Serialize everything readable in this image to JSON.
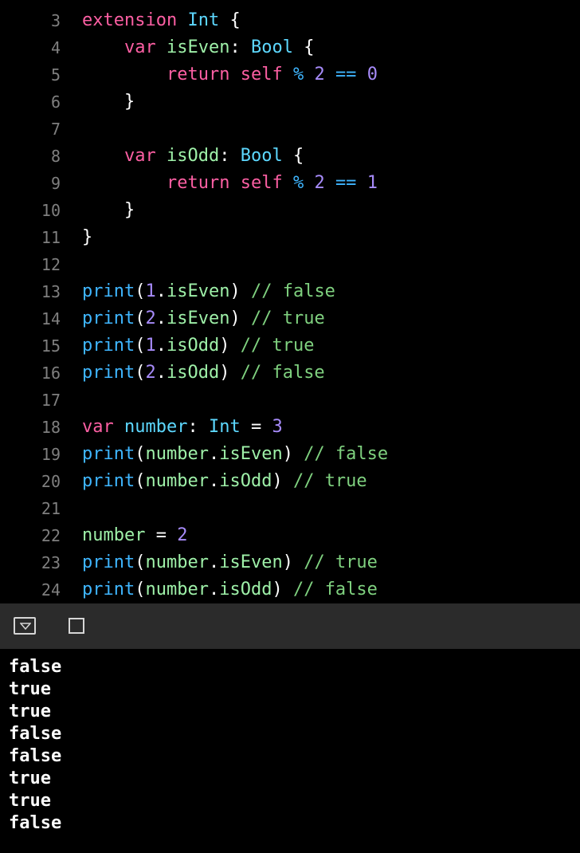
{
  "editor": {
    "lines": [
      {
        "n": "3",
        "tokens": [
          [
            "kw",
            "extension"
          ],
          [
            "pl",
            " "
          ],
          [
            "ty",
            "Int"
          ],
          [
            "pl",
            " {"
          ]
        ]
      },
      {
        "n": "4",
        "tokens": [
          [
            "pl",
            "    "
          ],
          [
            "kw",
            "var"
          ],
          [
            "pl",
            " "
          ],
          [
            "id2",
            "isEven"
          ],
          [
            "pl",
            ": "
          ],
          [
            "ty",
            "Bool"
          ],
          [
            "pl",
            " {"
          ]
        ]
      },
      {
        "n": "5",
        "tokens": [
          [
            "pl",
            "        "
          ],
          [
            "kw",
            "return"
          ],
          [
            "pl",
            " "
          ],
          [
            "kw",
            "self"
          ],
          [
            "pl",
            " "
          ],
          [
            "fn",
            "%"
          ],
          [
            "pl",
            " "
          ],
          [
            "num",
            "2"
          ],
          [
            "pl",
            " "
          ],
          [
            "fn",
            "=="
          ],
          [
            "pl",
            " "
          ],
          [
            "num",
            "0"
          ]
        ]
      },
      {
        "n": "6",
        "tokens": [
          [
            "pl",
            "    }"
          ]
        ]
      },
      {
        "n": "7",
        "tokens": []
      },
      {
        "n": "8",
        "tokens": [
          [
            "pl",
            "    "
          ],
          [
            "kw",
            "var"
          ],
          [
            "pl",
            " "
          ],
          [
            "id2",
            "isOdd"
          ],
          [
            "pl",
            ": "
          ],
          [
            "ty",
            "Bool"
          ],
          [
            "pl",
            " {"
          ]
        ]
      },
      {
        "n": "9",
        "tokens": [
          [
            "pl",
            "        "
          ],
          [
            "kw",
            "return"
          ],
          [
            "pl",
            " "
          ],
          [
            "kw",
            "self"
          ],
          [
            "pl",
            " "
          ],
          [
            "fn",
            "%"
          ],
          [
            "pl",
            " "
          ],
          [
            "num",
            "2"
          ],
          [
            "pl",
            " "
          ],
          [
            "fn",
            "=="
          ],
          [
            "pl",
            " "
          ],
          [
            "num",
            "1"
          ]
        ]
      },
      {
        "n": "10",
        "tokens": [
          [
            "pl",
            "    }"
          ]
        ]
      },
      {
        "n": "11",
        "tokens": [
          [
            "pl",
            "}"
          ]
        ]
      },
      {
        "n": "12",
        "tokens": []
      },
      {
        "n": "13",
        "tokens": [
          [
            "fn",
            "print"
          ],
          [
            "pl",
            "("
          ],
          [
            "num",
            "1"
          ],
          [
            "pl",
            "."
          ],
          [
            "id2",
            "isEven"
          ],
          [
            "pl",
            ") "
          ],
          [
            "cm",
            "// false"
          ]
        ]
      },
      {
        "n": "14",
        "tokens": [
          [
            "fn",
            "print"
          ],
          [
            "pl",
            "("
          ],
          [
            "num",
            "2"
          ],
          [
            "pl",
            "."
          ],
          [
            "id2",
            "isEven"
          ],
          [
            "pl",
            ") "
          ],
          [
            "cm",
            "// true"
          ]
        ]
      },
      {
        "n": "15",
        "tokens": [
          [
            "fn",
            "print"
          ],
          [
            "pl",
            "("
          ],
          [
            "num",
            "1"
          ],
          [
            "pl",
            "."
          ],
          [
            "id2",
            "isOdd"
          ],
          [
            "pl",
            ") "
          ],
          [
            "cm",
            "// true"
          ]
        ]
      },
      {
        "n": "16",
        "tokens": [
          [
            "fn",
            "print"
          ],
          [
            "pl",
            "("
          ],
          [
            "num",
            "2"
          ],
          [
            "pl",
            "."
          ],
          [
            "id2",
            "isOdd"
          ],
          [
            "pl",
            ") "
          ],
          [
            "cm",
            "// false"
          ]
        ]
      },
      {
        "n": "17",
        "tokens": []
      },
      {
        "n": "18",
        "tokens": [
          [
            "kw",
            "var"
          ],
          [
            "pl",
            " "
          ],
          [
            "ty",
            "number"
          ],
          [
            "pl",
            ": "
          ],
          [
            "ty",
            "Int"
          ],
          [
            "pl",
            " = "
          ],
          [
            "num",
            "3"
          ]
        ]
      },
      {
        "n": "19",
        "tokens": [
          [
            "fn",
            "print"
          ],
          [
            "pl",
            "("
          ],
          [
            "id2",
            "number"
          ],
          [
            "pl",
            "."
          ],
          [
            "id2",
            "isEven"
          ],
          [
            "pl",
            ") "
          ],
          [
            "cm",
            "// false"
          ]
        ]
      },
      {
        "n": "20",
        "tokens": [
          [
            "fn",
            "print"
          ],
          [
            "pl",
            "("
          ],
          [
            "id2",
            "number"
          ],
          [
            "pl",
            "."
          ],
          [
            "id2",
            "isOdd"
          ],
          [
            "pl",
            ") "
          ],
          [
            "cm",
            "// true"
          ]
        ]
      },
      {
        "n": "21",
        "tokens": []
      },
      {
        "n": "22",
        "tokens": [
          [
            "id2",
            "number"
          ],
          [
            "pl",
            " = "
          ],
          [
            "num",
            "2"
          ]
        ]
      },
      {
        "n": "23",
        "tokens": [
          [
            "fn",
            "print"
          ],
          [
            "pl",
            "("
          ],
          [
            "id2",
            "number"
          ],
          [
            "pl",
            "."
          ],
          [
            "id2",
            "isEven"
          ],
          [
            "pl",
            ") "
          ],
          [
            "cm",
            "// true"
          ]
        ]
      },
      {
        "n": "24",
        "tokens": [
          [
            "fn",
            "print"
          ],
          [
            "pl",
            "("
          ],
          [
            "id2",
            "number"
          ],
          [
            "pl",
            "."
          ],
          [
            "id2",
            "isOdd"
          ],
          [
            "pl",
            ") "
          ],
          [
            "cm",
            "// false"
          ]
        ]
      }
    ]
  },
  "toolbar": {
    "hide_icon": "chevron-down-box-icon",
    "stop_icon": "square-icon"
  },
  "console": {
    "output": [
      "false",
      "true",
      "true",
      "false",
      "false",
      "true",
      "true",
      "false"
    ]
  },
  "colors": {
    "keyword": "#fc5fa3",
    "type": "#5dd8ff",
    "identifier": "#9ef0a8",
    "number": "#a78bfa",
    "function": "#3fb6ff",
    "comment": "#7fd17f",
    "plain": "#ffffff",
    "line_number": "#7f7f7f",
    "toolbar_bg": "#2b2b2b",
    "background": "#000000"
  }
}
